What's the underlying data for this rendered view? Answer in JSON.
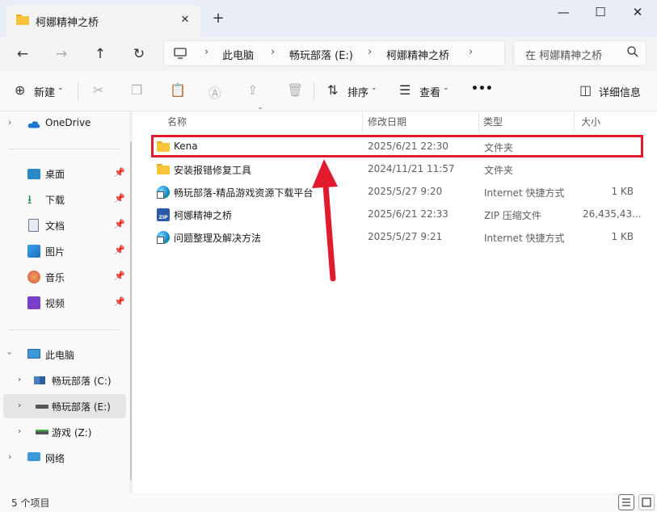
{
  "window": {
    "tab_title": "柯娜精神之桥",
    "tab_close": "✕",
    "new_tab": "+",
    "minimize": "—",
    "maximize": "☐",
    "close": "✕"
  },
  "nav": {
    "back": "←",
    "forward": "→",
    "up": "↑",
    "refresh": "↻",
    "breadcrumb": [
      "此电脑",
      "畅玩部落 (E:)",
      "柯娜精神之桥"
    ],
    "search_placeholder": "在 柯娜精神之桥"
  },
  "commands": {
    "new": "新建",
    "sort": "排序",
    "view": "查看",
    "more": "•••",
    "details": "详细信息"
  },
  "sidebar": {
    "onedrive": "OneDrive",
    "quick_access": [
      "桌面",
      "下载",
      "文档",
      "图片",
      "音乐",
      "视频"
    ],
    "this_pc": "此电脑",
    "drives": [
      "畅玩部落 (C:)",
      "畅玩部落 (E:)",
      "游戏 (Z:)"
    ],
    "network": "网络"
  },
  "columns": {
    "name": "名称",
    "modified": "修改日期",
    "type": "类型",
    "size": "大小"
  },
  "files": [
    {
      "name": "Kena",
      "modified": "2025/6/21 22:30",
      "type": "文件夹",
      "size": "",
      "icon": "folder-icon"
    },
    {
      "name": "安装报错修复工具",
      "modified": "2024/11/21 11:57",
      "type": "文件夹",
      "size": "",
      "icon": "folder-icon"
    },
    {
      "name": "畅玩部落-精品游戏资源下载平台",
      "modified": "2025/5/27 9:20",
      "type": "Internet 快捷方式",
      "size": "1 KB",
      "icon": "internet-shortcut-icon"
    },
    {
      "name": "柯娜精神之桥",
      "modified": "2025/6/21 22:33",
      "type": "ZIP 压缩文件",
      "size": "26,435,43...",
      "icon": "zip-icon"
    },
    {
      "name": "问题整理及解决方法",
      "modified": "2025/5/27 9:21",
      "type": "Internet 快捷方式",
      "size": "1 KB",
      "icon": "internet-shortcut-icon"
    }
  ],
  "status": {
    "item_count": "5 个项目"
  },
  "colors": {
    "highlight": "#e11b2b",
    "arrow": "#e11b2b",
    "folder": "#f8c43a"
  }
}
